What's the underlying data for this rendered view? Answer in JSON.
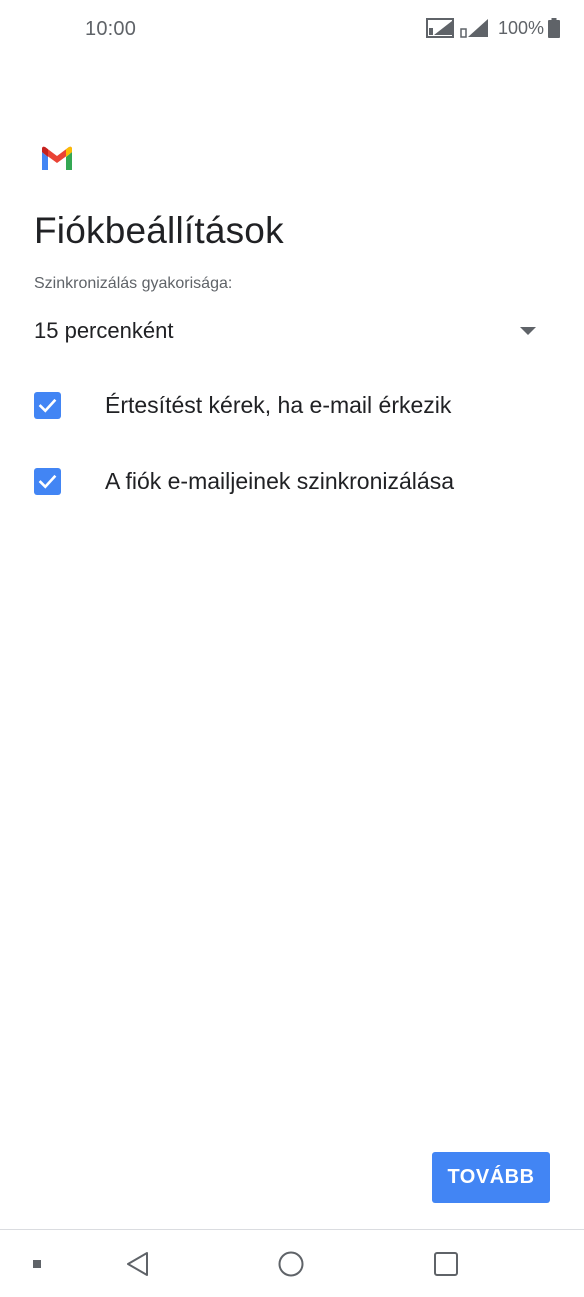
{
  "status_bar": {
    "time": "10:00",
    "battery_percent": "100%",
    "icons": [
      "sim1-signal-icon",
      "sim2-signal-icon",
      "battery-icon"
    ]
  },
  "app": {
    "logo": "gmail-logo-icon"
  },
  "page": {
    "title": "Fiókbeállítások",
    "sync_label": "Szinkronizálás gyakorisága:",
    "sync_value": "15 percenként"
  },
  "options": [
    {
      "label": "Értesítést kérek, ha e-mail érkezik",
      "checked": true
    },
    {
      "label": "A fiók e-mailjeinek szinkronizálása",
      "checked": true
    }
  ],
  "actions": {
    "next_label": "TOVÁBB"
  },
  "nav_bar": {
    "icons": [
      "menu-dot-icon",
      "back-icon",
      "home-icon",
      "recent-apps-icon"
    ]
  },
  "colors": {
    "accent": "#4285f4",
    "text_primary": "#202124",
    "text_secondary": "#5f6368"
  }
}
